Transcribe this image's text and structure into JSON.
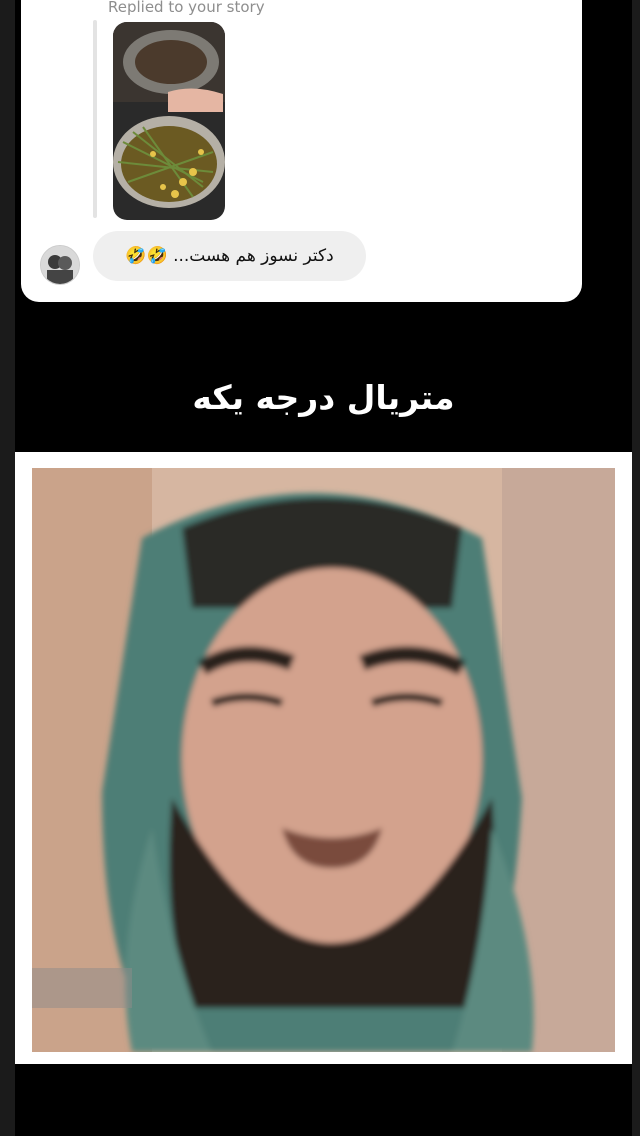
{
  "reply": {
    "label": "Replied to your story",
    "message": "دکتر نسوز هم هست... 🤣🤣"
  },
  "story": {
    "caption": "متریال درجه یکه"
  },
  "icons": {
    "avatar": "user-avatar",
    "thumbnail": "story-thumbnail",
    "meme": "meme-photo"
  }
}
